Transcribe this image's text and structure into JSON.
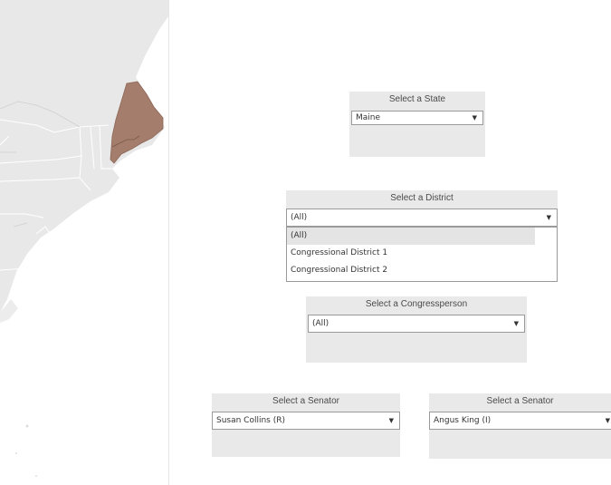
{
  "map": {
    "highlighted_state": "Maine",
    "highlight_color": "#a57d6c",
    "land_color": "#e8e8e8",
    "water_color": "#ffffff",
    "border_color": "#ffffff"
  },
  "state_filter": {
    "title": "Select a State",
    "value": "Maine"
  },
  "district_filter": {
    "title": "Select a District",
    "value": "(All)",
    "options": [
      "(All)",
      "Congressional District 1",
      "Congressional District 2"
    ],
    "highlighted_option": "(All)"
  },
  "congressperson_filter": {
    "title": "Select a Congressperson",
    "value": "(All)"
  },
  "senator_filter_1": {
    "title": "Select a Senator",
    "value": "Susan Collins (R)"
  },
  "senator_filter_2": {
    "title": "Select a Senator",
    "value": "Angus King (I)"
  },
  "icons": {
    "dropdown": "caret-down-icon"
  }
}
